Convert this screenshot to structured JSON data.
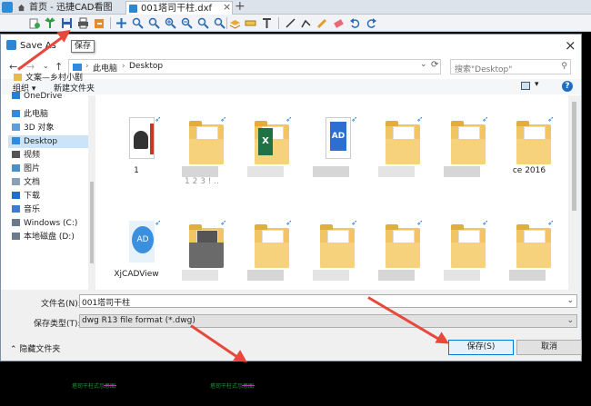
{
  "app": {
    "home_tab": "首页 - 迅捷CAD看图",
    "file_tab": "001塔司干柱.dxf",
    "close_glyph": "×",
    "new_tab_glyph": "+"
  },
  "toolbar": {
    "tooltip": "保存",
    "icons": [
      "add-file-icon",
      "palm-icon",
      "save-icon",
      "print-icon",
      "export-icon",
      "move-icon",
      "zoom-window-icon",
      "zoom-in-icon",
      "zoom-out-icon",
      "zoom-extents-icon",
      "zoom-all-icon",
      "layer-icon",
      "measure-icon",
      "text-icon",
      "line-icon",
      "pencil-icon",
      "eraser-icon",
      "undo-icon",
      "redo-icon"
    ]
  },
  "dialog": {
    "title": "Save As",
    "nav": {
      "back": "←",
      "forward": "→",
      "dropdown": "⌄",
      "up": "↑",
      "crumb_sep": "›",
      "breadcrumb": [
        "此电脑",
        "Desktop"
      ],
      "search_placeholder": "搜索\"Desktop\""
    },
    "commands": {
      "organize": "组织 ▾",
      "new_folder": "新建文件夹"
    },
    "sidebar": [
      {
        "label": "文案—乡村小剧",
        "icon": "folder",
        "color": "#e8b84a"
      },
      {
        "label": "OneDrive",
        "icon": "cloud",
        "color": "#2b7cd3"
      },
      {
        "label": "此电脑",
        "icon": "pc",
        "color": "#2f8be0"
      },
      {
        "label": "3D 对象",
        "icon": "3d",
        "color": "#5aa0e0"
      },
      {
        "label": "Desktop",
        "icon": "desktop",
        "color": "#2f8be0",
        "selected": true
      },
      {
        "label": "视频",
        "icon": "video",
        "color": "#555"
      },
      {
        "label": "图片",
        "icon": "picture",
        "color": "#4a90c8"
      },
      {
        "label": "文档",
        "icon": "document",
        "color": "#8aa0b8"
      },
      {
        "label": "下载",
        "icon": "download",
        "color": "#1f6fc9"
      },
      {
        "label": "音乐",
        "icon": "music",
        "color": "#3a7bd5"
      },
      {
        "label": "Windows (C:)",
        "icon": "drive",
        "color": "#6b7b8c"
      },
      {
        "label": "本地磁盘 (D:)",
        "icon": "drive",
        "color": "#6b7b8c"
      }
    ],
    "files": [
      {
        "kind": "doc",
        "label": "1"
      },
      {
        "kind": "folder",
        "label": "1 2 3 ! ..",
        "blurred": true
      },
      {
        "kind": "xls",
        "label": "",
        "blurred": true
      },
      {
        "kind": "cad",
        "label": "",
        "blurred": true
      },
      {
        "kind": "folder",
        "label": "",
        "blurred": true
      },
      {
        "kind": "folder",
        "label": "",
        "blurred": true
      },
      {
        "kind": "folder",
        "label": "ce 2016"
      },
      {
        "kind": "cadapp",
        "label": "XjCADView"
      },
      {
        "kind": "photo",
        "label": "",
        "blurred": true
      },
      {
        "kind": "folder",
        "label": "",
        "blurred": true
      },
      {
        "kind": "folder",
        "label": "",
        "blurred": true
      },
      {
        "kind": "folder",
        "label": "",
        "blurred": true
      },
      {
        "kind": "folder",
        "label": "",
        "blurred": true
      },
      {
        "kind": "folder",
        "label": "",
        "blurred": true
      }
    ],
    "filename_label": "文件名(N):",
    "filename_value": "001塔司干柱",
    "filetype_label": "保存类型(T):",
    "filetype_value": "dwg R13 file format (*.dwg)",
    "hide_folders": "隐藏文件夹",
    "save_button": "保存(S)",
    "cancel_button": "取消"
  },
  "canvas": {
    "label1": "塔司干柱式示意图",
    "label2": "塔司干柱式示意图"
  },
  "colors": {
    "annotation_arrow": "#e8483c",
    "selection": "#cce4f7",
    "primary_border": "#0078d7"
  }
}
